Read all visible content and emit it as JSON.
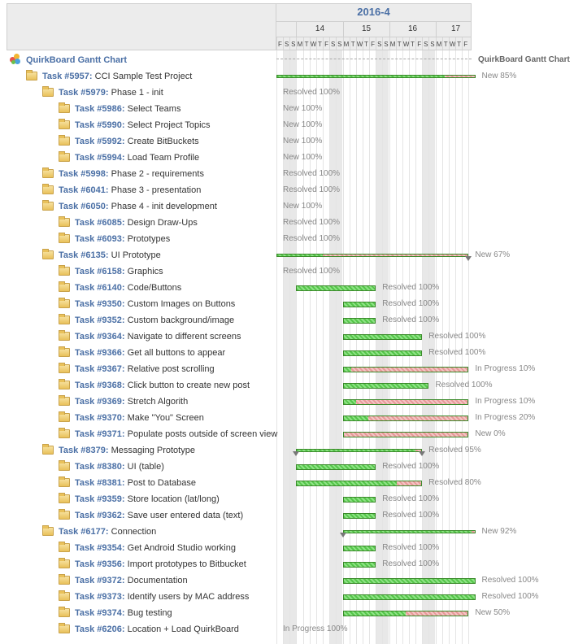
{
  "header": {
    "month": "2016-4",
    "weeks": [
      "14",
      "15",
      "16",
      "17"
    ],
    "days": [
      "F",
      "S",
      "S",
      "M",
      "T",
      "W",
      "T",
      "F",
      "S",
      "S",
      "M",
      "T",
      "W",
      "T",
      "F",
      "S",
      "S",
      "M",
      "T",
      "W",
      "T",
      "F",
      "S",
      "S",
      "M",
      "T",
      "W",
      "T",
      "F"
    ]
  },
  "root": {
    "title": "QuirkBoard Gantt Chart",
    "status": "QuirkBoard Gantt Chart"
  },
  "rows": [
    {
      "indent": 1,
      "id": "Task #5957:",
      "name": "CCI Sample Test Project",
      "kind": "parent",
      "start": 0,
      "end": 30,
      "progress": 0.85,
      "status": "New 85%"
    },
    {
      "indent": 2,
      "id": "Task #5979:",
      "name": "Phase 1 - init",
      "kind": "text",
      "status": "Resolved 100%"
    },
    {
      "indent": 3,
      "id": "Task #5986:",
      "name": "Select Teams",
      "kind": "text",
      "status": "New 100%"
    },
    {
      "indent": 3,
      "id": "Task #5990:",
      "name": "Select Project Topics",
      "kind": "text",
      "status": "New 100%"
    },
    {
      "indent": 3,
      "id": "Task #5992:",
      "name": "Create BitBuckets",
      "kind": "text",
      "status": "New 100%"
    },
    {
      "indent": 3,
      "id": "Task #5994:",
      "name": "Load Team Profile",
      "kind": "text",
      "status": "New 100%"
    },
    {
      "indent": 2,
      "id": "Task #5998:",
      "name": "Phase 2 - requirements",
      "kind": "text",
      "status": "Resolved 100%"
    },
    {
      "indent": 2,
      "id": "Task #6041:",
      "name": "Phase 3 - presentation",
      "kind": "text",
      "status": "Resolved 100%"
    },
    {
      "indent": 2,
      "id": "Task #6050:",
      "name": "Phase 4 - init development",
      "kind": "text",
      "status": "New 100%"
    },
    {
      "indent": 3,
      "id": "Task #6085:",
      "name": "Design Draw-Ups",
      "kind": "text",
      "status": "Resolved 100%"
    },
    {
      "indent": 3,
      "id": "Task #6093:",
      "name": "Prototypes",
      "kind": "text",
      "status": "Resolved 100%"
    },
    {
      "indent": 2,
      "id": "Task #6135:",
      "name": "UI Prototype",
      "kind": "parent",
      "start": 0,
      "end": 29,
      "progress": 0.24,
      "status": "New 67%",
      "markerEnd": true
    },
    {
      "indent": 3,
      "id": "Task #6158:",
      "name": "Graphics",
      "kind": "text",
      "status": "Resolved 100%"
    },
    {
      "indent": 3,
      "id": "Task #6140:",
      "name": "Code/Buttons",
      "kind": "bar",
      "start": 3,
      "end": 15,
      "progress": 1,
      "status": "Resolved 100%"
    },
    {
      "indent": 3,
      "id": "Task #9350:",
      "name": "Custom Images on Buttons",
      "kind": "bar",
      "start": 10,
      "end": 15,
      "progress": 1,
      "status": "Resolved 100%"
    },
    {
      "indent": 3,
      "id": "Task #9352:",
      "name": "Custom background/image",
      "kind": "bar",
      "start": 10,
      "end": 15,
      "progress": 1,
      "status": "Resolved 100%"
    },
    {
      "indent": 3,
      "id": "Task #9364:",
      "name": "Navigate to different screens",
      "kind": "bar",
      "start": 10,
      "end": 22,
      "progress": 1,
      "status": "Resolved 100%"
    },
    {
      "indent": 3,
      "id": "Task #9366:",
      "name": "Get all buttons to appear",
      "kind": "bar",
      "start": 10,
      "end": 22,
      "progress": 1,
      "status": "Resolved 100%"
    },
    {
      "indent": 3,
      "id": "Task #9367:",
      "name": "Relative post scrolling",
      "kind": "bar",
      "start": 10,
      "end": 29,
      "progress": 0.06,
      "status": "In Progress 10%"
    },
    {
      "indent": 3,
      "id": "Task #9368:",
      "name": "Click button to create new post",
      "kind": "bar",
      "start": 10,
      "end": 23,
      "progress": 1,
      "status": "Resolved 100%"
    },
    {
      "indent": 3,
      "id": "Task #9369:",
      "name": "Stretch Algorith",
      "kind": "bar",
      "start": 10,
      "end": 29,
      "progress": 0.1,
      "status": "In Progress 10%"
    },
    {
      "indent": 3,
      "id": "Task #9370:",
      "name": "Make \"You\" Screen",
      "kind": "bar",
      "start": 10,
      "end": 29,
      "progress": 0.2,
      "status": "In Progress 20%"
    },
    {
      "indent": 3,
      "id": "Task #9371:",
      "name": "Populate posts outside of screen view",
      "kind": "bar",
      "start": 10,
      "end": 29,
      "progress": 0,
      "status": "New 0%"
    },
    {
      "indent": 2,
      "id": "Task #8379:",
      "name": "Messaging Prototype",
      "kind": "parent",
      "start": 3,
      "end": 22,
      "progress": 0.95,
      "status": "Resolved 95%",
      "markerStart": true,
      "markerEnd": true
    },
    {
      "indent": 3,
      "id": "Task #8380:",
      "name": "UI (table)",
      "kind": "bar",
      "start": 3,
      "end": 15,
      "progress": 1,
      "status": "Resolved 100%"
    },
    {
      "indent": 3,
      "id": "Task #8381:",
      "name": "Post to Database",
      "kind": "bar",
      "start": 3,
      "end": 22,
      "progress": 0.8,
      "status": "Resolved 80%"
    },
    {
      "indent": 3,
      "id": "Task #9359:",
      "name": "Store location (lat/long)",
      "kind": "bar",
      "start": 10,
      "end": 15,
      "progress": 1,
      "status": "Resolved 100%"
    },
    {
      "indent": 3,
      "id": "Task #9362:",
      "name": "Save user entered data (text)",
      "kind": "bar",
      "start": 10,
      "end": 15,
      "progress": 1,
      "status": "Resolved 100%"
    },
    {
      "indent": 2,
      "id": "Task #6177:",
      "name": "Connection",
      "kind": "parent",
      "start": 10,
      "end": 30,
      "progress": 0.98,
      "status": "New 92%",
      "markerStart": true
    },
    {
      "indent": 3,
      "id": "Task #9354:",
      "name": "Get Android Studio working",
      "kind": "bar",
      "start": 10,
      "end": 15,
      "progress": 1,
      "status": "Resolved 100%"
    },
    {
      "indent": 3,
      "id": "Task #9356:",
      "name": "Import prototypes to Bitbucket",
      "kind": "bar",
      "start": 10,
      "end": 15,
      "progress": 1,
      "status": "Resolved 100%"
    },
    {
      "indent": 3,
      "id": "Task #9372:",
      "name": "Documentation",
      "kind": "bar",
      "start": 10,
      "end": 30,
      "progress": 1,
      "status": "Resolved 100%"
    },
    {
      "indent": 3,
      "id": "Task #9373:",
      "name": "Identify users by MAC address",
      "kind": "bar",
      "start": 10,
      "end": 30,
      "progress": 1,
      "status": "Resolved 100%"
    },
    {
      "indent": 3,
      "id": "Task #9374:",
      "name": "Bug testing",
      "kind": "bar",
      "start": 10,
      "end": 29,
      "progress": 0.5,
      "status": "New 50%"
    },
    {
      "indent": 3,
      "id": "Task #6206:",
      "name": "Location + Load QuirkBoard",
      "kind": "text",
      "status": "In Progress 100%"
    }
  ]
}
